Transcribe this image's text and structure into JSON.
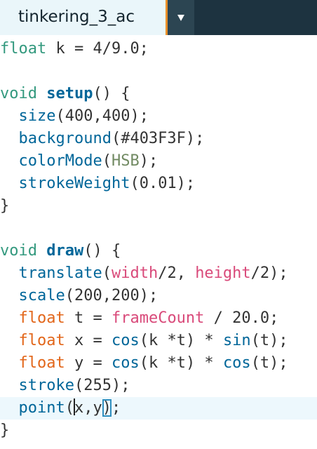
{
  "tab": {
    "title": "tinkering_3_ac",
    "menu_icon": "triangle-down-icon"
  },
  "colors": {
    "tab_bar_bg": "#1d3340",
    "tab_active_bg": "#eaf6fa",
    "tab_accent": "#e8902a",
    "keyword": "#e2661a",
    "type": "#33997e",
    "function": "#006699",
    "variable": "#d94a7a",
    "constant": "#718a62",
    "current_line_bg": "#edf8fd",
    "bracket_highlight": "#2f8fbf"
  },
  "code": {
    "l1": {
      "kw": "float",
      "rest": " k = 4/9.0;"
    },
    "l3": {
      "kw": "void",
      "sp": " ",
      "fn": "setup",
      "rest": "() {"
    },
    "l4": {
      "ind": "  ",
      "fn": "size",
      "rest": "(400,400);"
    },
    "l5": {
      "ind": "  ",
      "fn": "background",
      "rest": "(#403F3F);"
    },
    "l6": {
      "ind": "  ",
      "fn": "colorMode",
      "a": "(",
      "c": "HSB",
      "b": ");"
    },
    "l7": {
      "ind": "  ",
      "fn": "strokeWeight",
      "rest": "(0.01);"
    },
    "l8": {
      "text": "}"
    },
    "l10": {
      "kw": "void",
      "sp": " ",
      "fn": "draw",
      "rest": "() {"
    },
    "l11": {
      "ind": "  ",
      "fn": "translate",
      "a": "(",
      "v1": "width",
      "b": "/2, ",
      "v2": "height",
      "c": "/2);"
    },
    "l12": {
      "ind": "  ",
      "fn": "scale",
      "rest": "(200,200);"
    },
    "l13": {
      "ind": "  ",
      "kw": "float",
      "a": " t = ",
      "v": "frameCount",
      "b": " / 20.0;"
    },
    "l14": {
      "ind": "  ",
      "kw": "float",
      "a": " x = ",
      "f1": "cos",
      "b": "(k *t) * ",
      "f2": "sin",
      "c": "(t);"
    },
    "l15": {
      "ind": "  ",
      "kw": "float",
      "a": " y = ",
      "f1": "cos",
      "b": "(k *t) * ",
      "f2": "cos",
      "c": "(t);"
    },
    "l16": {
      "ind": "  ",
      "fn": "stroke",
      "rest": "(255);"
    },
    "l17": {
      "ind": "  ",
      "fn": "point",
      "a": "(",
      "b": "x,y",
      "c": ")",
      "d": ";"
    },
    "l18": {
      "text": "}"
    }
  }
}
